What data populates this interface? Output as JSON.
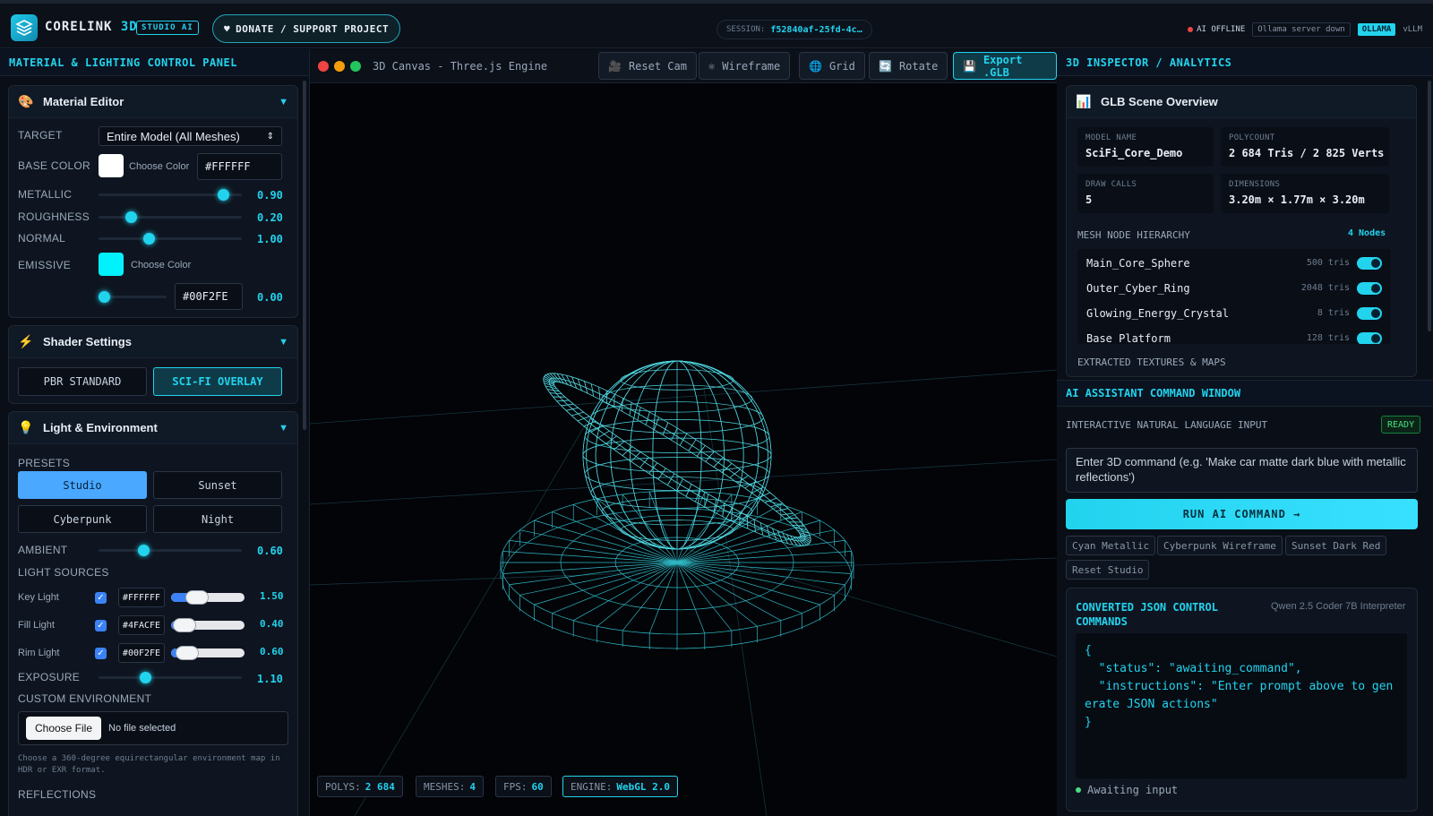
{
  "header": {
    "brand_main": "CORELINK",
    "brand_accent": "3D",
    "badge": "STUDIO AI",
    "donate_label": "DONATE / SUPPORT PROJECT",
    "session_label": "SESSION:",
    "session_value": "f52840af-25fd-4c…",
    "ai_status": "AI OFFLINE",
    "server_status": "Ollama server down",
    "engine_active": "OLLAMA",
    "engine_alt": "vLLM"
  },
  "left": {
    "title": "MATERIAL & LIGHTING CONTROL PANEL",
    "material": {
      "title": "Material Editor",
      "target_label": "TARGET",
      "target_value": "Entire Model (All Meshes)",
      "base_color_label": "BASE COLOR",
      "choose_color": "Choose Color",
      "base_hex": "#FFFFFF",
      "metallic_label": "METALLIC",
      "metallic": "0.90",
      "roughness_label": "ROUGHNESS",
      "roughness": "0.20",
      "normal_label": "NORMAL",
      "normal": "1.00",
      "emissive_label": "EMISSIVE",
      "emissive_hex": "#00F2FE",
      "emissive_val": "0.00"
    },
    "shader": {
      "title": "Shader Settings",
      "pbr": "PBR STANDARD",
      "scifi": "SCI-FI OVERLAY"
    },
    "light": {
      "title": "Light & Environment",
      "presets_label": "PRESETS",
      "studio": "Studio",
      "sunset": "Sunset",
      "cyberpunk": "Cyberpunk",
      "night": "Night",
      "ambient_label": "AMBIENT",
      "ambient": "0.60",
      "sources_label": "LIGHT SOURCES",
      "key_label": "Key Light",
      "key_hex": "#FFFFFF",
      "key_val": "1.50",
      "fill_label": "Fill Light",
      "fill_hex": "#4FACFE",
      "fill_val": "0.40",
      "rim_label": "Rim Light",
      "rim_hex": "#00F2FE",
      "rim_val": "0.60",
      "exposure_label": "EXPOSURE",
      "exposure": "1.10",
      "custom_env_label": "CUSTOM ENVIRONMENT",
      "choose_file": "Choose File",
      "no_file": "No file selected",
      "env_help": "Choose a 360-degree equirectangular environment map in HDR or EXR format.",
      "reflections_label": "REFLECTIONS"
    }
  },
  "canvas": {
    "title": "3D Canvas - Three.js Engine",
    "reset_cam": "Reset Cam",
    "wireframe": "Wireframe",
    "grid": "Grid",
    "rotate": "Rotate",
    "export": "Export .GLB",
    "polys_label": "POLYS:",
    "polys": "2 684",
    "meshes_label": "MESHES:",
    "meshes": "4",
    "fps_label": "FPS:",
    "fps": "60",
    "engine_label": "ENGINE:",
    "engine": "WebGL 2.0"
  },
  "inspector": {
    "title": "3D INSPECTOR / ANALYTICS",
    "overview_title": "GLB Scene Overview",
    "model_name_label": "MODEL NAME",
    "model_name": "SciFi_Core_Demo",
    "polycount_label": "POLYCOUNT",
    "polycount": "2 684 Tris / 2 825 Verts",
    "draw_calls_label": "DRAW CALLS",
    "draw_calls": "5",
    "dimensions_label": "DIMENSIONS",
    "dimensions": "3.20m × 1.77m × 3.20m",
    "hierarchy_label": "MESH NODE HIERARCHY",
    "node_count": "4 Nodes",
    "meshes": [
      {
        "name": "Main_Core_Sphere",
        "tris": "500 tris"
      },
      {
        "name": "Outer_Cyber_Ring",
        "tris": "2048 tris"
      },
      {
        "name": "Glowing_Energy_Crystal",
        "tris": "8 tris"
      },
      {
        "name": "Base_Platform",
        "tris": "128 tris"
      }
    ],
    "textures_label": "EXTRACTED TEXTURES & MAPS"
  },
  "ai": {
    "title": "AI ASSISTANT COMMAND WINDOW",
    "input_label": "INTERACTIVE NATURAL LANGUAGE INPUT",
    "status": "READY",
    "placeholder": "Enter 3D command (e.g. 'Make car matte dark blue with metallic reflections')",
    "run": "RUN AI COMMAND →",
    "chips": [
      "Cyan Metallic",
      "Cyberpunk Wireframe",
      "Sunset Dark Red",
      "Reset Studio"
    ],
    "json_title": "CONVERTED JSON CONTROL COMMANDS",
    "model": "Qwen 2.5 Coder 7B Interpreter",
    "code": "{\n  \"status\": \"awaiting_command\",\n  \"instructions\": \"Enter prompt above to generate JSON actions\"\n}",
    "awaiting": "Awaiting input"
  },
  "colors": {
    "accent": "#22d3ee",
    "emissive": "#00F2FE",
    "fill": "#4FACFE",
    "base": "#FFFFFF"
  }
}
